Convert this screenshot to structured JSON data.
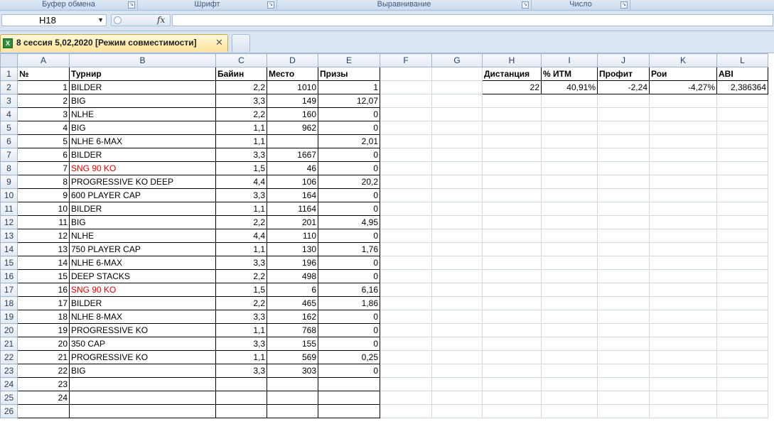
{
  "ribbon": {
    "groups": [
      "Буфер обмена",
      "Шрифт",
      "Выравнивание",
      "Число"
    ]
  },
  "formula_bar": {
    "name_box": "H18",
    "fx_label": "fx",
    "formula": ""
  },
  "workbook_tab": {
    "title": "8 сессия 5,02,2020  [Режим совместимости]",
    "icon": "excel-icon",
    "close": "✕"
  },
  "sheet": {
    "columns": [
      "A",
      "B",
      "C",
      "D",
      "E",
      "F",
      "G",
      "H",
      "I",
      "J",
      "K",
      "L"
    ],
    "headers": {
      "num": "№",
      "tournament": "Турнир",
      "buyin": "Байин",
      "place": "Место",
      "prize": "Призы"
    },
    "rows": [
      {
        "n": "1",
        "name": "BILDER",
        "buyin": "2,2",
        "place": "1010",
        "prize": "1",
        "red": false
      },
      {
        "n": "2",
        "name": "BIG",
        "buyin": "3,3",
        "place": "149",
        "prize": "12,07",
        "red": false
      },
      {
        "n": "3",
        "name": "NLHE",
        "buyin": "2,2",
        "place": "160",
        "prize": "0",
        "red": false
      },
      {
        "n": "4",
        "name": "BIG",
        "buyin": "1,1",
        "place": "962",
        "prize": "0",
        "red": false
      },
      {
        "n": "5",
        "name": "NLHE 6-MAX",
        "buyin": "1,1",
        "place": "",
        "prize": "2,01",
        "red": false
      },
      {
        "n": "6",
        "name": "BILDER",
        "buyin": "3,3",
        "place": "1667",
        "prize": "0",
        "red": false
      },
      {
        "n": "7",
        "name": "SNG 90 KO",
        "buyin": "1,5",
        "place": "46",
        "prize": "0",
        "red": true
      },
      {
        "n": "8",
        "name": "PROGRESSIVE KO DEEP",
        "buyin": "4,4",
        "place": "106",
        "prize": "20,2",
        "red": false
      },
      {
        "n": "9",
        "name": "600 PLAYER CAP",
        "buyin": "3,3",
        "place": "164",
        "prize": "0",
        "red": false
      },
      {
        "n": "10",
        "name": "BILDER",
        "buyin": "1,1",
        "place": "1164",
        "prize": "0",
        "red": false
      },
      {
        "n": "11",
        "name": "BIG",
        "buyin": "2,2",
        "place": "201",
        "prize": "4,95",
        "red": false
      },
      {
        "n": "12",
        "name": "NLHE",
        "buyin": "4,4",
        "place": "110",
        "prize": "0",
        "red": false
      },
      {
        "n": "13",
        "name": "750 PLAYER CAP",
        "buyin": "1,1",
        "place": "130",
        "prize": "1,76",
        "red": false
      },
      {
        "n": "14",
        "name": "NLHE 6-MAX",
        "buyin": "3,3",
        "place": "196",
        "prize": "0",
        "red": false
      },
      {
        "n": "15",
        "name": "DEEP STACKS",
        "buyin": "2,2",
        "place": "498",
        "prize": "0",
        "red": false
      },
      {
        "n": "16",
        "name": "SNG 90 KO",
        "buyin": "1,5",
        "place": "6",
        "prize": "6,16",
        "red": true
      },
      {
        "n": "17",
        "name": "BILDER",
        "buyin": "2,2",
        "place": "465",
        "prize": "1,86",
        "red": false
      },
      {
        "n": "18",
        "name": "NLHE 8-MAX",
        "buyin": "3,3",
        "place": "162",
        "prize": "0",
        "red": false
      },
      {
        "n": "19",
        "name": "PROGRESSIVE KO",
        "buyin": "1,1",
        "place": "768",
        "prize": "0",
        "red": false
      },
      {
        "n": "20",
        "name": "350 CAP",
        "buyin": "3,3",
        "place": "155",
        "prize": "0",
        "red": false
      },
      {
        "n": "21",
        "name": "PROGRESSIVE KO",
        "buyin": "1,1",
        "place": "569",
        "prize": "0,25",
        "red": false
      },
      {
        "n": "22",
        "name": "BIG",
        "buyin": "3,3",
        "place": "303",
        "prize": "0",
        "red": false
      },
      {
        "n": "23",
        "name": "",
        "buyin": "",
        "place": "",
        "prize": "",
        "red": false
      },
      {
        "n": "24",
        "name": "",
        "buyin": "",
        "place": "",
        "prize": "",
        "red": false
      }
    ],
    "row_numbers": [
      "1",
      "2",
      "3",
      "4",
      "5",
      "6",
      "7",
      "8",
      "9",
      "10",
      "11",
      "12",
      "13",
      "14",
      "15",
      "16",
      "17",
      "18",
      "19",
      "20",
      "21",
      "22",
      "23",
      "24",
      "25",
      "26"
    ],
    "stats": {
      "headers": [
        "Дистанция",
        "% ИТМ",
        "Профит",
        "Рои",
        "ABI"
      ],
      "values": [
        "22",
        "40,91%",
        "-2,24",
        "-4,27%",
        "2,386364"
      ]
    }
  },
  "colors": {
    "red_text": "#e00000",
    "tab_fill": "#ffe39b"
  }
}
